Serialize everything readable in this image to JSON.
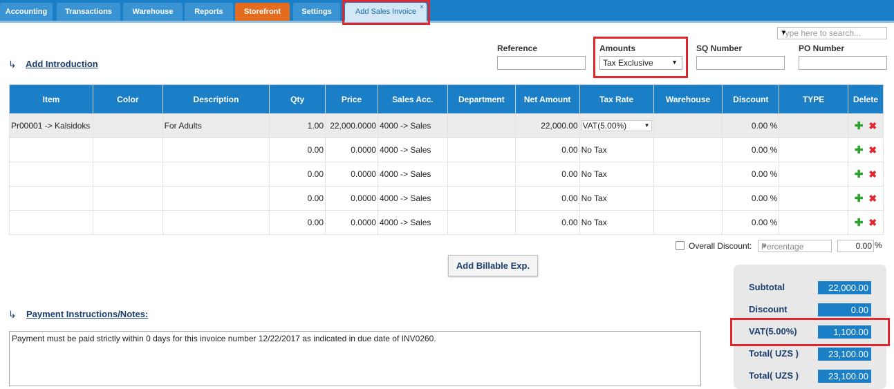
{
  "tabs": [
    "Accounting",
    "Transactions",
    "Warehouse",
    "Reports",
    "Storefront",
    "Settings",
    "Add Sales Invoice"
  ],
  "tab_close": "×",
  "search": {
    "placeholder": "Type here to search..."
  },
  "add_introduction": "Add Introduction",
  "fields": {
    "reference": "Reference",
    "amounts": "Amounts",
    "amounts_value": "Tax Exclusive",
    "sq_number": "SQ Number",
    "po_number": "PO Number"
  },
  "table": {
    "headers": [
      "Item",
      "Color",
      "Description",
      "Qty",
      "Price",
      "Sales Acc.",
      "Department",
      "Net Amount",
      "Tax Rate",
      "Warehouse",
      "Discount",
      "TYPE",
      "Delete"
    ],
    "rows": [
      {
        "item": "Pr00001 -> Kalsidoks",
        "color": "",
        "description": "For Adults",
        "qty": "1.00",
        "price": "22,000.0000",
        "sales_acc": "4000 -> Sales",
        "department": "",
        "net_amount": "22,000.00",
        "tax_rate": "VAT(5.00%)",
        "warehouse": "",
        "discount": "0.00 %",
        "type": ""
      },
      {
        "item": "",
        "color": "",
        "description": "",
        "qty": "0.00",
        "price": "0.0000",
        "sales_acc": "4000 -> Sales",
        "department": "",
        "net_amount": "0.00",
        "tax_rate": "No Tax",
        "warehouse": "",
        "discount": "0.00 %",
        "type": ""
      },
      {
        "item": "",
        "color": "",
        "description": "",
        "qty": "0.00",
        "price": "0.0000",
        "sales_acc": "4000 -> Sales",
        "department": "",
        "net_amount": "0.00",
        "tax_rate": "No Tax",
        "warehouse": "",
        "discount": "0.00 %",
        "type": ""
      },
      {
        "item": "",
        "color": "",
        "description": "",
        "qty": "0.00",
        "price": "0.0000",
        "sales_acc": "4000 -> Sales",
        "department": "",
        "net_amount": "0.00",
        "tax_rate": "No Tax",
        "warehouse": "",
        "discount": "0.00 %",
        "type": ""
      },
      {
        "item": "",
        "color": "",
        "description": "",
        "qty": "0.00",
        "price": "0.0000",
        "sales_acc": "4000 -> Sales",
        "department": "",
        "net_amount": "0.00",
        "tax_rate": "No Tax",
        "warehouse": "",
        "discount": "0.00 %",
        "type": ""
      }
    ],
    "add_icon": "✚",
    "delete_icon": "✖"
  },
  "overall_discount": {
    "label": "Overall Discount:",
    "type": "Percentage",
    "value": "0.00",
    "unit": "%"
  },
  "add_billable": "Add Billable Exp.",
  "payment_notes": {
    "label": "Payment Instructions/Notes:",
    "text": "Payment must be paid strictly within 0 days for this invoice number 12/22/2017 as indicated in due date of INV0260."
  },
  "totals": [
    {
      "label": "Subtotal",
      "value": "22,000.00"
    },
    {
      "label": "Discount",
      "value": "0.00"
    },
    {
      "label": "VAT(5.00%)",
      "value": "1,100.00"
    },
    {
      "label": "Total( UZS )",
      "value": "23,100.00"
    },
    {
      "label": "Total( UZS )",
      "value": "23,100.00"
    }
  ],
  "colors": {
    "primary": "#1a7fc6",
    "accent": "#e46c1e",
    "highlight": "#e3252c"
  }
}
